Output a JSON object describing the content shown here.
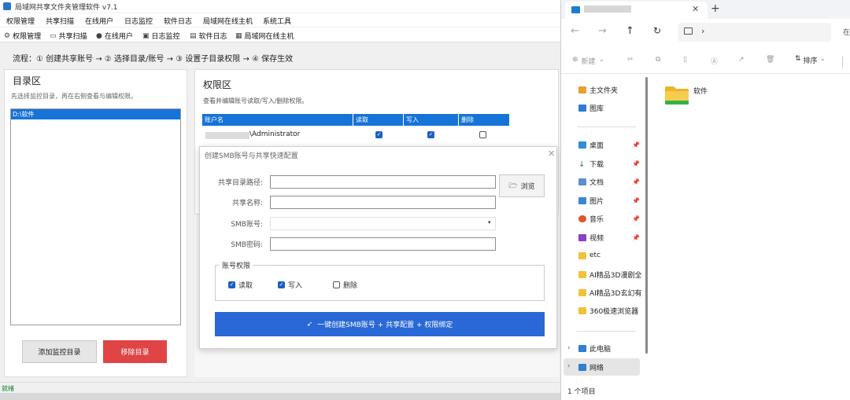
{
  "app": {
    "title": "局域网共享文件夹管理软件 v7.1",
    "menu": [
      "权限管理",
      "共享扫描",
      "在线用户",
      "日志监控",
      "软件日志",
      "局域网在线主机",
      "系统工具"
    ],
    "toolbar": [
      {
        "label": "权限管理",
        "icon": "gear-icon"
      },
      {
        "label": "共享扫描",
        "icon": "folder-icon"
      },
      {
        "label": "在线用户",
        "icon": "globe-icon"
      },
      {
        "label": "日志监控",
        "icon": "log-icon"
      },
      {
        "label": "软件日志",
        "icon": "file-icon"
      },
      {
        "label": "局域网在线主机",
        "icon": "computer-icon"
      }
    ],
    "flow": "流程：① 创建共享账号 → ② 选择目录/账号 → ③ 设置子目录权限 → ④ 保存生效",
    "dir": {
      "title": "目录区",
      "hint": "先选择监控目录，再在右侧查看与编辑权限。",
      "items": [
        "D:\\软件"
      ],
      "add_label": "添加监控目录",
      "remove_label": "移除目录"
    },
    "perm": {
      "title": "权限区",
      "hint": "查看并编辑账号读取/写入/删除权限。",
      "headers": [
        "账户名",
        "读取",
        "写入",
        "删除"
      ],
      "rows": [
        {
          "account": "\\Administrator",
          "read": true,
          "write": true,
          "delete": false
        }
      ]
    },
    "status": "就绪"
  },
  "dialog": {
    "title": "创建SMB账号与共享快速配置",
    "fields": {
      "path_label": "共享目录路径:",
      "name_label": "共享名称:",
      "account_label": "SMB账号:",
      "password_label": "SMB密码:"
    },
    "browse_label": "浏览",
    "perm_group": "账号权限",
    "perm_options": [
      {
        "label": "读取",
        "checked": true
      },
      {
        "label": "写入",
        "checked": true
      },
      {
        "label": "删除",
        "checked": false
      }
    ],
    "submit_label": "一键创建SMB账号 + 共享配置 + 权限绑定",
    "accent": "#2968d6"
  },
  "explorer": {
    "commands": {
      "new": "新建",
      "sort": "排序"
    },
    "nav": {
      "top": [
        {
          "label": "主文件夹",
          "icon": "home-icon"
        },
        {
          "label": "图库",
          "icon": "gallery-icon"
        }
      ],
      "quick": [
        {
          "label": "桌面",
          "icon": "desktop-icon"
        },
        {
          "label": "下载",
          "icon": "download-icon"
        },
        {
          "label": "文档",
          "icon": "document-icon"
        },
        {
          "label": "图片",
          "icon": "picture-icon"
        },
        {
          "label": "音乐",
          "icon": "music-icon"
        },
        {
          "label": "视频",
          "icon": "video-icon"
        },
        {
          "label": "etc",
          "icon": "folder-icon"
        },
        {
          "label": "AI精品3D漫剧全",
          "icon": "folder-icon"
        },
        {
          "label": "AI精品3D玄幻有",
          "icon": "folder-icon"
        },
        {
          "label": "360极速浏览器",
          "icon": "folder-icon"
        }
      ],
      "bottom": [
        {
          "label": "此电脑",
          "icon": "computer-icon"
        },
        {
          "label": "网络",
          "icon": "network-icon"
        }
      ]
    },
    "folder": {
      "name": "软件"
    },
    "item_count": "1 个项目"
  }
}
